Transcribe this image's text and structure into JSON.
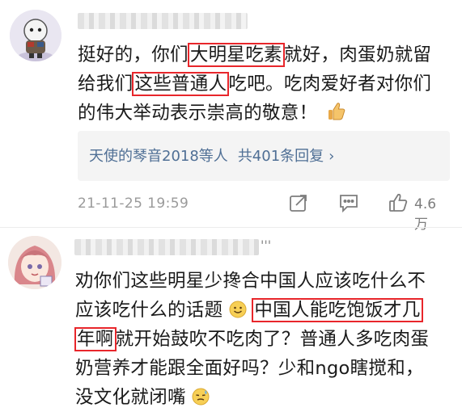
{
  "comment1": {
    "lines": [
      {
        "pre": "挺好的，你们",
        "hl": "大明星吃素",
        "post": "就好，肉蛋奶就留"
      },
      {
        "pre": "给我们",
        "hl": "这些普通人",
        "post": "吃吧。吃肉爱好者对你们"
      },
      {
        "pre": "的伟大举动表示崇高的敬意！",
        "hl": "",
        "post": ""
      }
    ],
    "reply_summary": "天使的琴音2018等人",
    "reply_count": "共401条回复",
    "timestamp": "21-11-25 19:59",
    "like_count": "4.6万"
  },
  "comment2": {
    "name_suffix": "'''",
    "line1": "劝你们这些明星少搀合中国人应该吃什么不",
    "line2_pre": "应该吃什么的话题",
    "line2_hl": "中国人能吃饱饭才几",
    "line3_hl": "年啊",
    "line3_post": "就开始鼓吹不吃肉了？普通人多吃肉蛋",
    "line4": "奶营养才能跟全面好吗？少和ngo瞎搅和，",
    "line5": "没文化就闭嘴"
  },
  "icons": {
    "share": "share-icon",
    "comment": "comment-icon",
    "like": "thumbs-up-icon",
    "thumbs_emoji": "thumbs-up-emoji",
    "smile_emoji": "smile-emoji",
    "sweat_emoji": "sweat-emoji"
  },
  "colors": {
    "highlight": "#e8262b",
    "link": "#4f6f95",
    "meta": "#9a9a9a"
  }
}
